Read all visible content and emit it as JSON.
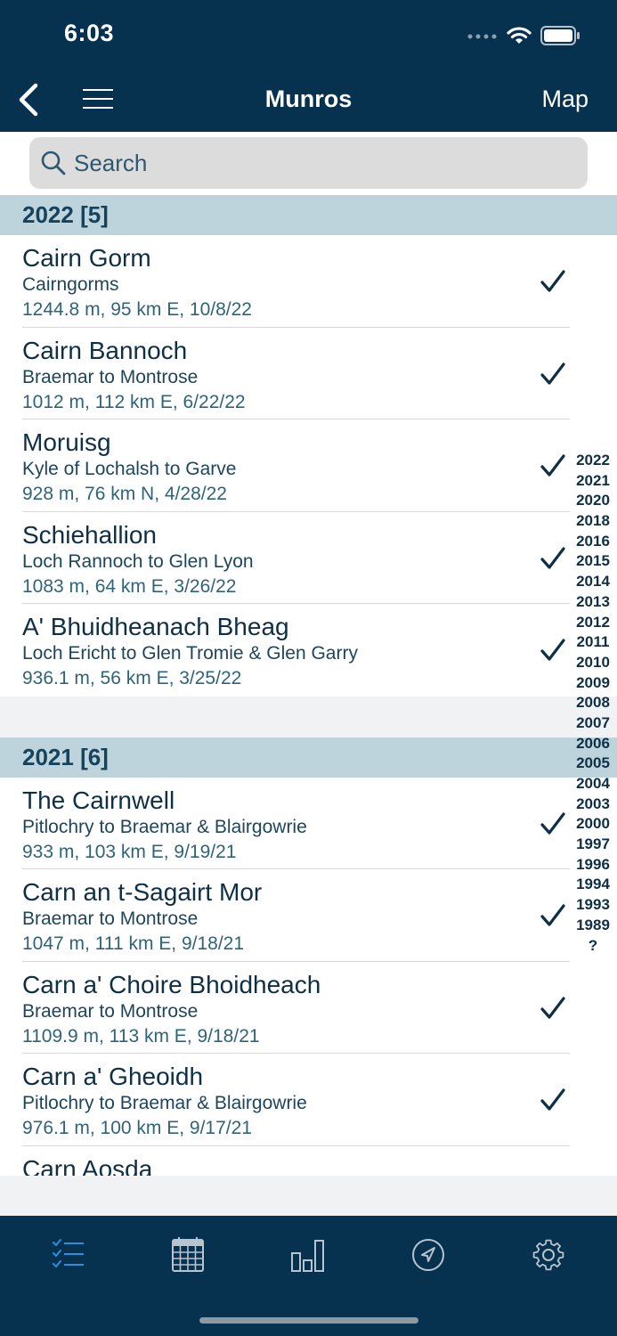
{
  "status_bar": {
    "time": "6:03"
  },
  "nav": {
    "title": "Munros",
    "map_label": "Map"
  },
  "search": {
    "placeholder": "Search"
  },
  "sections": [
    {
      "header": "2022 [5]",
      "items": [
        {
          "name": "Cairn Gorm",
          "region": "Cairngorms",
          "detail": "1244.8 m, 95 km E, 10/8/22"
        },
        {
          "name": "Cairn Bannoch",
          "region": "Braemar to Montrose",
          "detail": "1012 m, 112 km E, 6/22/22"
        },
        {
          "name": "Moruisg",
          "region": "Kyle of Lochalsh to Garve",
          "detail": "928 m, 76 km N, 4/28/22"
        },
        {
          "name": "Schiehallion",
          "region": "Loch Rannoch to Glen Lyon",
          "detail": "1083 m, 64 km E, 3/26/22"
        },
        {
          "name": "A' Bhuidheanach Bheag",
          "region": "Loch Ericht to Glen Tromie & Glen Garry",
          "detail": "936.1 m, 56 km E, 3/25/22"
        }
      ]
    },
    {
      "header": "2021 [6]",
      "items": [
        {
          "name": "The Cairnwell",
          "region": "Pitlochry to Braemar & Blairgowrie",
          "detail": "933 m, 103 km E, 9/19/21"
        },
        {
          "name": "Carn an t-Sagairt Mor",
          "region": "Braemar to Montrose",
          "detail": "1047 m, 111 km E, 9/18/21"
        },
        {
          "name": "Carn a' Choire Bhoidheach",
          "region": "Braemar to Montrose",
          "detail": "1109.9 m, 113 km E, 9/18/21"
        },
        {
          "name": "Carn a' Gheoidh",
          "region": "Pitlochry to Braemar & Blairgowrie",
          "detail": "976.1 m, 100 km E, 9/17/21"
        },
        {
          "name": "Carn Aosda",
          "region": "",
          "detail": ""
        }
      ]
    }
  ],
  "year_index": [
    "2022",
    "2021",
    "2020",
    "2018",
    "2016",
    "2015",
    "2014",
    "2013",
    "2012",
    "2011",
    "2010",
    "2009",
    "2008",
    "2007",
    "2006",
    "2005",
    "2004",
    "2003",
    "2000",
    "1997",
    "1996",
    "1994",
    "1993",
    "1989",
    "?"
  ],
  "tabs": [
    {
      "icon": "list-check-icon",
      "active": true
    },
    {
      "icon": "calendar-icon",
      "active": false
    },
    {
      "icon": "bar-chart-icon",
      "active": false
    },
    {
      "icon": "navigation-arrow-icon",
      "active": false
    },
    {
      "icon": "gear-icon",
      "active": false
    }
  ],
  "colors": {
    "header_bg": "#06314f",
    "section_bg": "#bdd4dd",
    "active_tab": "#2f8fd8",
    "inactive_tab": "#b8c4cf"
  }
}
